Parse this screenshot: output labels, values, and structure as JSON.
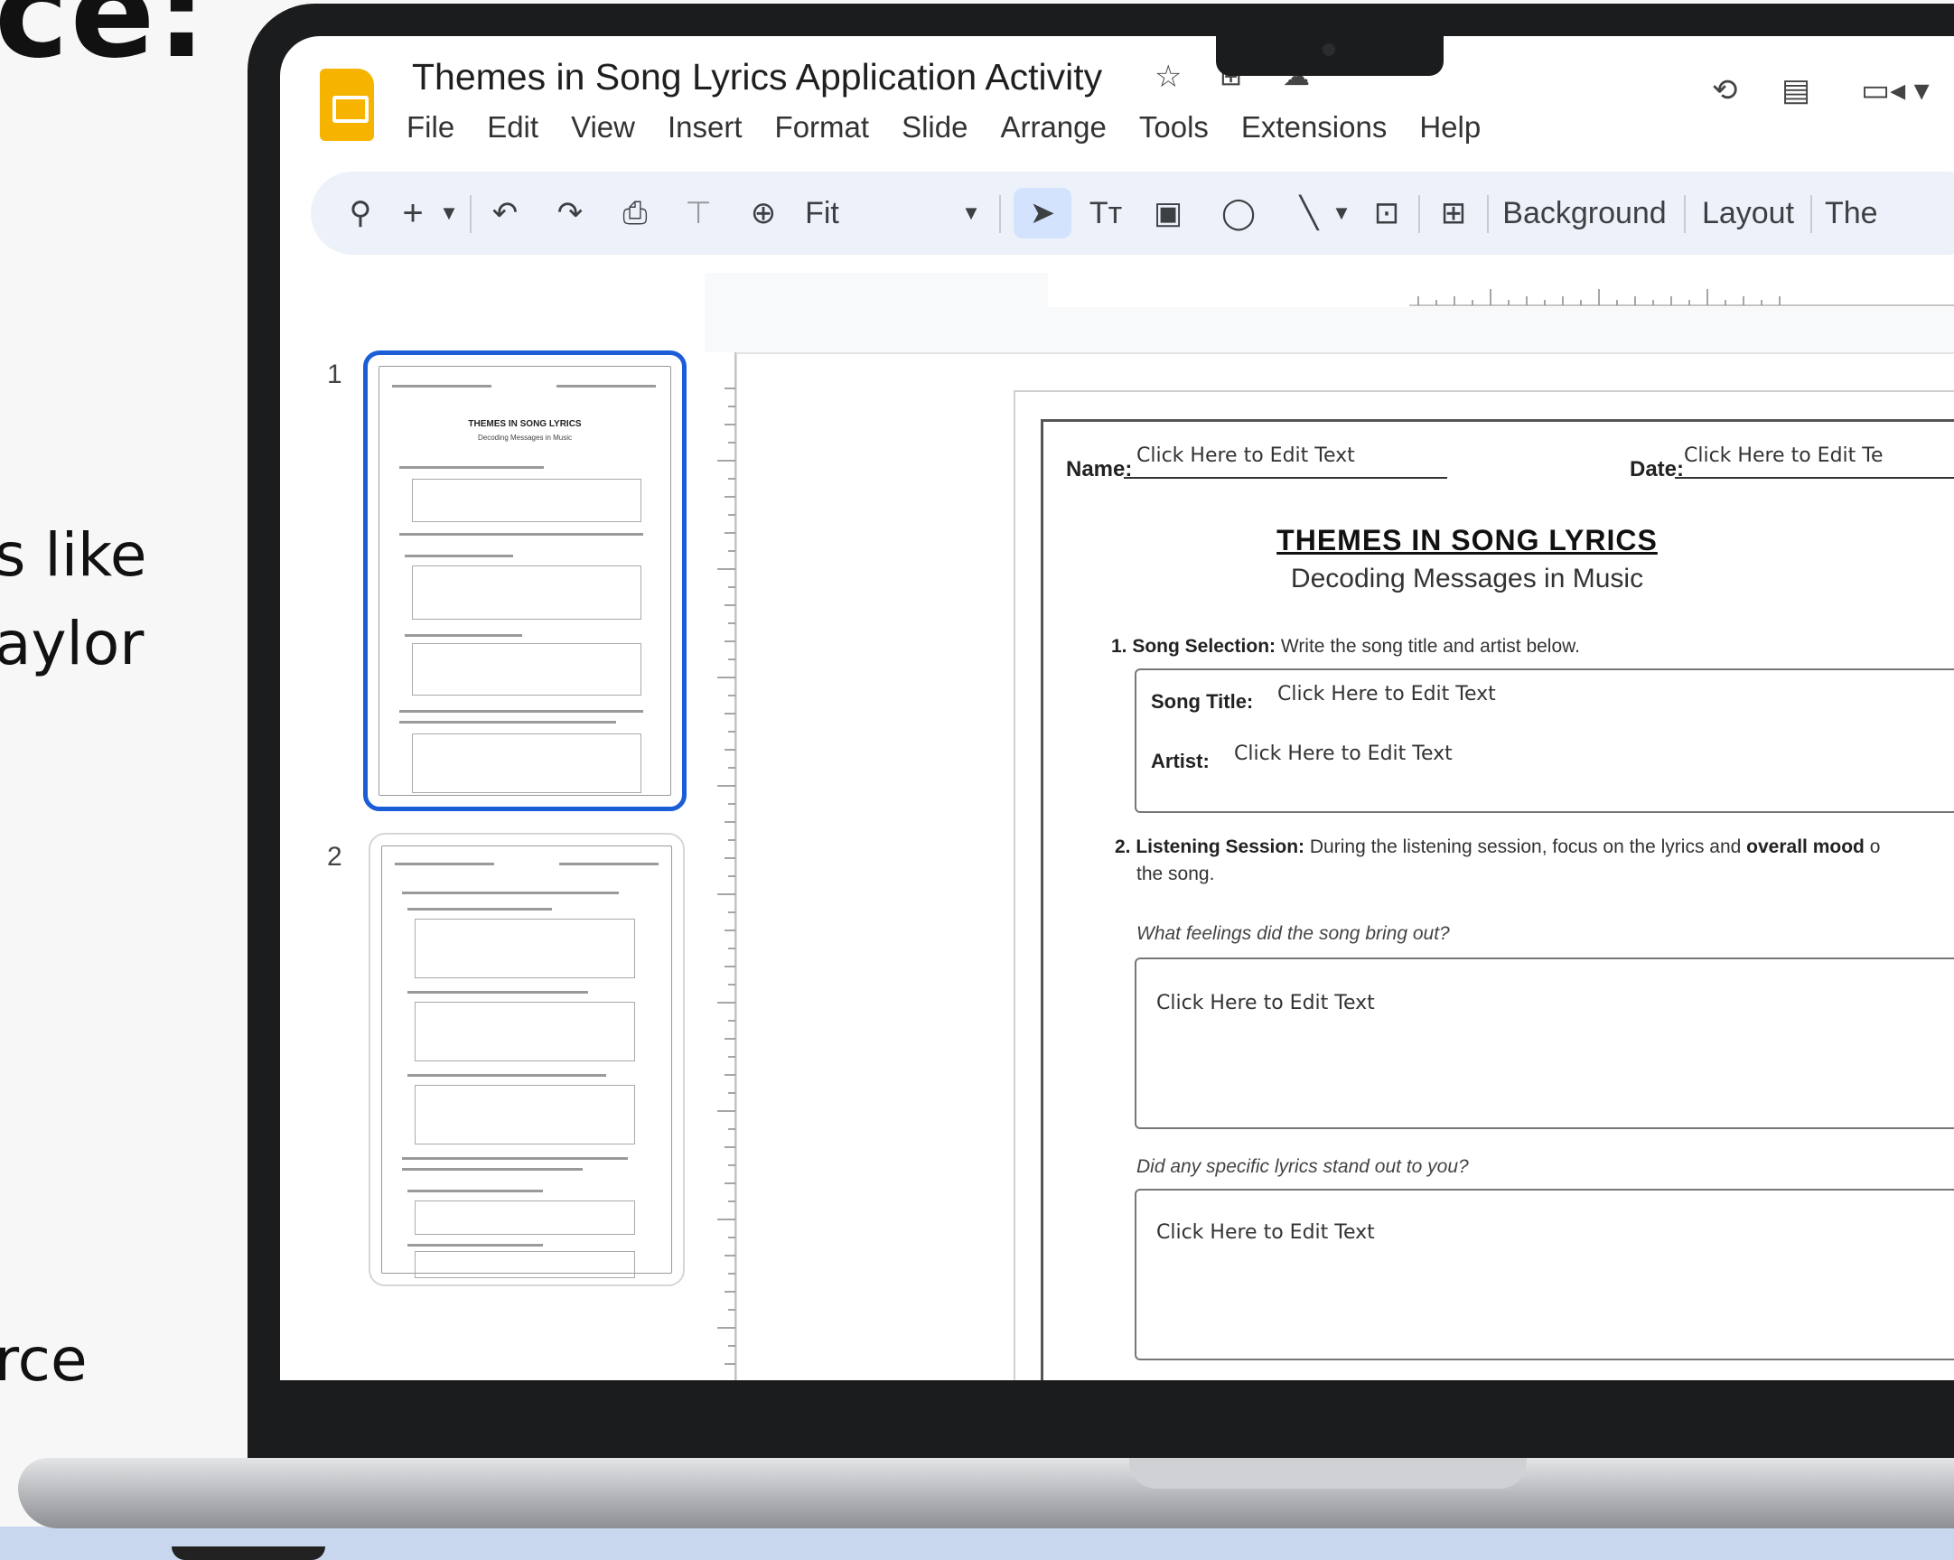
{
  "background_fragments": {
    "top": "ce:",
    "line1": "s like",
    "line2": "aylor",
    "line3": "rce"
  },
  "app": {
    "title": "Themes in Song Lyrics Application Activity",
    "menu": [
      "File",
      "Edit",
      "View",
      "Insert",
      "Format",
      "Slide",
      "Arrange",
      "Tools",
      "Extensions",
      "Help"
    ]
  },
  "toolbar": {
    "zoom_label": "Fit",
    "background_label": "Background",
    "layout_label": "Layout",
    "theme_label": "The"
  },
  "slides": {
    "numbers": [
      "1",
      "2"
    ],
    "thumb_title": "THEMES IN SONG LYRICS",
    "thumb_subtitle": "Decoding Messages in Music"
  },
  "worksheet": {
    "name_label": "Name:",
    "name_value": "Click Here to Edit Text",
    "date_label": "Date:",
    "date_value": "Click Here to Edit Te",
    "title": "THEMES IN SONG LYRICS",
    "subtitle": "Decoding Messages in Music",
    "q1_label": "1. Song Selection:",
    "q1_text": "Write the song title and artist below.",
    "song_title_label": "Song Title:",
    "song_title_value": "Click Here to Edit Text",
    "artist_label": "Artist:",
    "artist_value": "Click Here to Edit Text",
    "q2_label": "2. Listening Session:",
    "q2_text_a": "During the listening session, focus on the lyrics and",
    "q2_bold": "overall mood",
    "q2_text_b": "o",
    "q2_text_c": "the song.",
    "prompt1": "What feelings did the song bring out?",
    "answer1": "Click Here to Edit Text",
    "prompt2": "Did any specific lyrics stand out to you?",
    "answer2": "Click Here to Edit Text"
  }
}
